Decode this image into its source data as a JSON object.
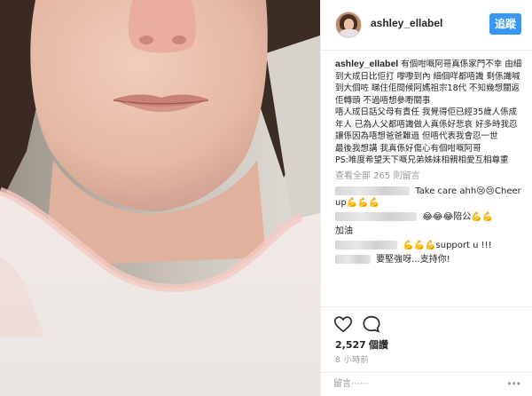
{
  "post": {
    "username": "ashley_ellabel",
    "follow_label": "追蹤",
    "caption_user": "ashley_ellabel",
    "caption_p1": "有個咁嘅阿哥真係家門不幸 由細到大成日比佢打 嚟嚟到內 細個咩都唔識 剩係識喊 到大個咗 睇住佢間候阿媽祖宗18代 不知幾想關返佢轉頭 不過唔想參嘢關事",
    "caption_p2": "唔人成日話父母有責任 我覺得佢已經35歲人係成年人 已為人父都唔識做人真係好悲哀 好多時我忍讓係因為唔想爸爸難過 但唔代表我會忍一世",
    "caption_p3": "最後我想講 我真係好傷心有個咁嘅阿哥",
    "caption_p4": "PS:唯度希望天下嘅兄弟姊妹相親相愛互相尊重",
    "view_all": "查看全部 265 則留言",
    "comments": [
      {
        "text": "Take care ahh😢😢Cheer up💪💪💪"
      },
      {
        "text": "😂😂😂陪公💪💪"
      },
      {
        "text": "加油"
      },
      {
        "text": "💪💪💪support u !!!"
      },
      {
        "text": "要堅強呀...支持你!"
      }
    ],
    "likes_count": "2,527",
    "likes_suffix": "個讚",
    "time_ago": "8 小時前",
    "comment_placeholder": "留言⋯⋯",
    "more_label": "•••"
  },
  "icons": {
    "like": "heart-icon",
    "comment": "comment-icon",
    "more": "more-options-icon"
  },
  "colors": {
    "follow_button": "#3897f0",
    "muted_text": "#999999"
  }
}
